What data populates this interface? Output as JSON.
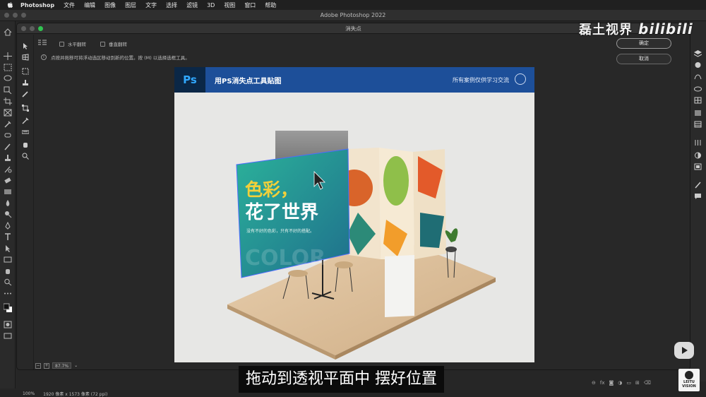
{
  "menubar": {
    "app_name": "Photoshop",
    "items": [
      "文件",
      "编辑",
      "图像",
      "图层",
      "文字",
      "选择",
      "滤镜",
      "3D",
      "视图",
      "窗口",
      "帮助"
    ]
  },
  "window": {
    "title": "Adobe Photoshop 2022"
  },
  "dialog": {
    "title": "消失点",
    "options": {
      "flip_horizontal": "水平翻转",
      "flip_vertical": "垂直翻转"
    },
    "hint": "点按并拖移可将浮动选区移动到新的位置。按 (M) 以选择选框工具。",
    "ok_label": "确定",
    "cancel_label": "取消",
    "zoom_value": "87.7%"
  },
  "canvas": {
    "banner_logo": "Ps",
    "banner_title": "用PS消失点工具贴图",
    "banner_note": "所有案例仅供学习交流",
    "poster_line1": "色彩，",
    "poster_line2": "花了世界",
    "poster_tagline": "没有不好的色彩，只有不好的搭配。",
    "poster_bg_text": "COLOR"
  },
  "status": {
    "zoom": "100%",
    "doc_info": "1920 像素 x 1573 像素 (72 ppi)"
  },
  "overlay": {
    "watermark": "磊土视界",
    "watermark_brand": "bilibili",
    "subtitle": "拖动到透视平面中 摆好位置",
    "brand_label": "LEITU VISION"
  },
  "colors": {
    "accent_blue": "#1d4f99",
    "poster_teal": "#1a9a8f",
    "poster_yellow": "#f1d03a"
  }
}
